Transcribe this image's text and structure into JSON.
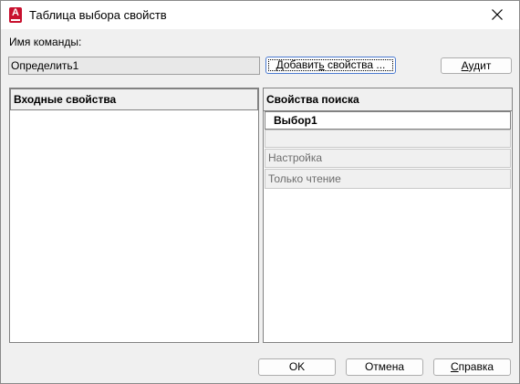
{
  "window": {
    "title": "Таблица выбора свойств"
  },
  "command": {
    "label": "Имя команды:",
    "value": "Определить1"
  },
  "buttons": {
    "add_pre": "Добавит",
    "add_u": "ь",
    "add_post": " свойства ...",
    "audit_pre": "",
    "audit_u": "А",
    "audit_post": "удит",
    "ok": "OK",
    "cancel": "Отмена",
    "help_pre": "",
    "help_u": "С",
    "help_post": "правка"
  },
  "left_panel": {
    "header": "Входные свойства"
  },
  "right_panel": {
    "header": "Свойства поиска",
    "rows": [
      {
        "label": "Выбор1"
      },
      {
        "label": ""
      },
      {
        "label": "Настройка"
      },
      {
        "label": "Только чтение"
      }
    ]
  }
}
